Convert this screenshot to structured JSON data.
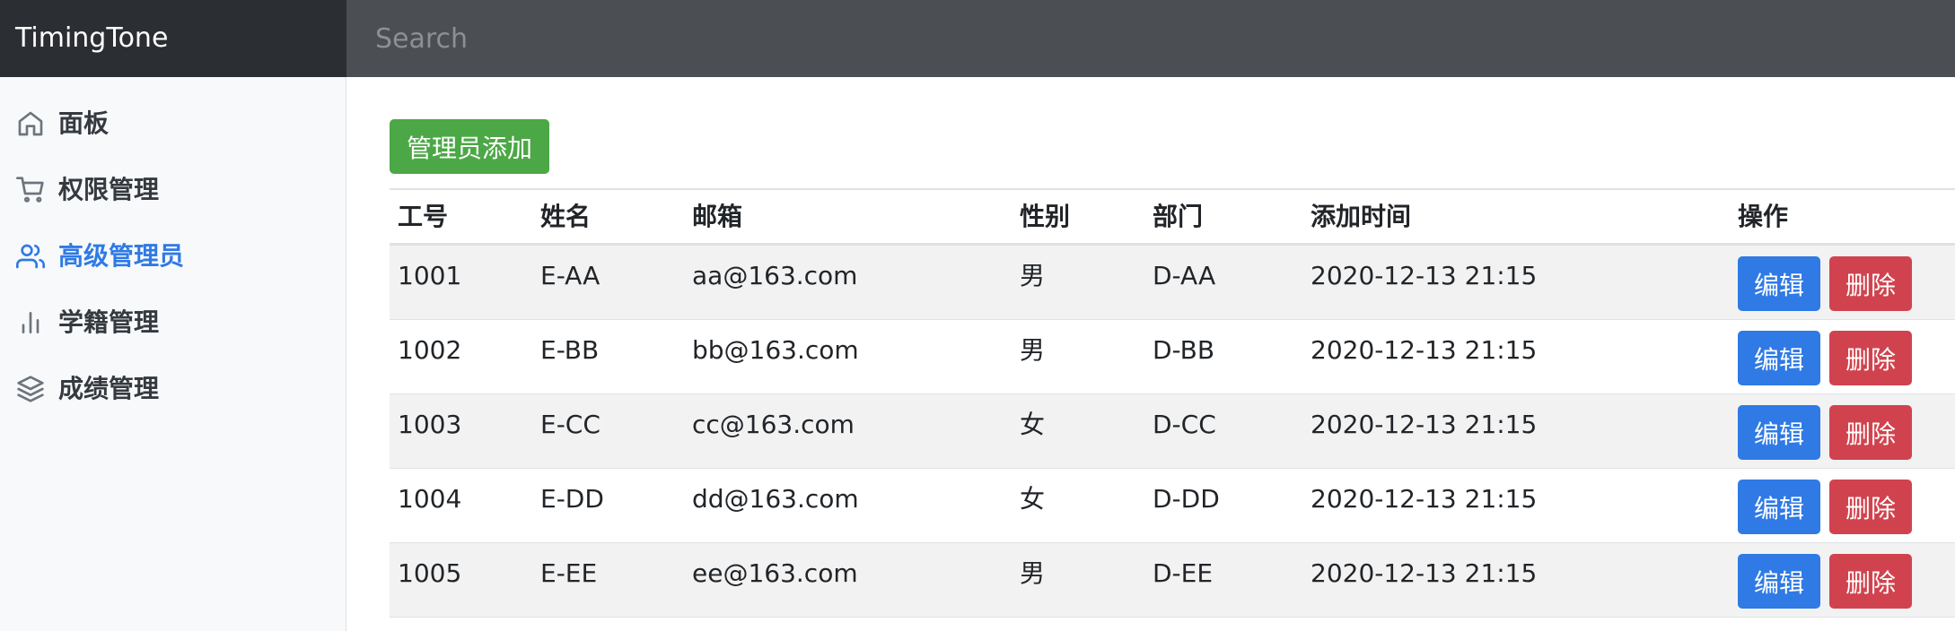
{
  "brand": "TimingTone",
  "search": {
    "placeholder": "Search"
  },
  "sidebar": {
    "items": [
      {
        "label": "面板",
        "icon": "home-icon",
        "active": false
      },
      {
        "label": "权限管理",
        "icon": "shopping-cart-icon",
        "active": false
      },
      {
        "label": "高级管理员",
        "icon": "users-icon",
        "active": true
      },
      {
        "label": "学籍管理",
        "icon": "bar-chart-icon",
        "active": false
      },
      {
        "label": "成绩管理",
        "icon": "layers-icon",
        "active": false
      }
    ]
  },
  "main": {
    "add_button": "管理员添加",
    "table": {
      "headers": [
        "工号",
        "姓名",
        "邮箱",
        "性别",
        "部门",
        "添加时间",
        "操作"
      ],
      "rows": [
        [
          "1001",
          "E-AA",
          "aa@163.com",
          "男",
          "D-AA",
          "2020-12-13 21:15"
        ],
        [
          "1002",
          "E-BB",
          "bb@163.com",
          "男",
          "D-BB",
          "2020-12-13 21:15"
        ],
        [
          "1003",
          "E-CC",
          "cc@163.com",
          "女",
          "D-CC",
          "2020-12-13 21:15"
        ],
        [
          "1004",
          "E-DD",
          "dd@163.com",
          "女",
          "D-DD",
          "2020-12-13 21:15"
        ],
        [
          "1005",
          "E-EE",
          "ee@163.com",
          "男",
          "D-EE",
          "2020-12-13 21:15"
        ]
      ],
      "edit_label": "编辑",
      "delete_label": "删除"
    }
  },
  "colors": {
    "topbar": "#4b4e53",
    "brand_bg": "#2b2e32",
    "accent": "#2f7ae5",
    "success": "#4ca846",
    "danger": "#d0434e"
  }
}
